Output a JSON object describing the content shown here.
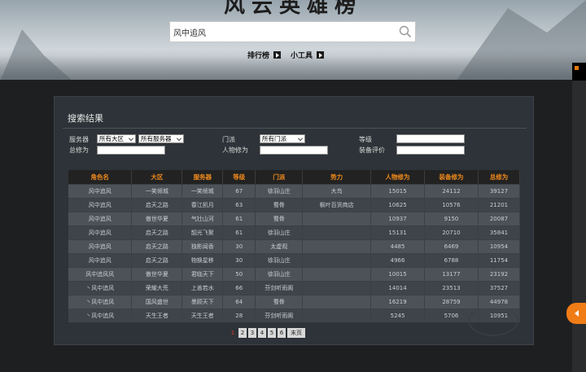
{
  "header": {
    "logo_text": "风云英雄榜",
    "search": {
      "value": "风中追风"
    },
    "nav": [
      {
        "label": "排行榜"
      },
      {
        "label": "小工具"
      }
    ]
  },
  "results": {
    "title": "搜索结果",
    "filters": {
      "server_label": "服务器",
      "region_select": "所有大区",
      "server_select": "所有服务器",
      "sect_label": "门派",
      "sect_select": "所有门派",
      "level_label": "等级",
      "total_power_label": "总修为",
      "char_power_label": "人物修为",
      "equip_label": "装备评价"
    },
    "columns": [
      "角色名",
      "大区",
      "服务器",
      "等级",
      "门派",
      "势力",
      "人物修为",
      "装备修为",
      "总修为"
    ],
    "rows": [
      [
        "风中追风",
        "一笑倾城",
        "一笑倾城",
        "67",
        "徐羽山庄",
        "大鸟",
        "15015",
        "24112",
        "39127"
      ],
      [
        "风中追风",
        "启天之路",
        "春江凯月",
        "63",
        "蜀骨",
        "枫叶百货商店",
        "10625",
        "10576",
        "21201"
      ],
      [
        "风中追风",
        "傲世华夏",
        "气壮山河",
        "61",
        "蜀骨",
        "",
        "10937",
        "9150",
        "20087"
      ],
      [
        "风中追风",
        "启天之路",
        "韶光飞絮",
        "61",
        "徐羽山庄",
        "",
        "15131",
        "20710",
        "35841"
      ],
      [
        "风中追风",
        "启天之路",
        "独影闻香",
        "30",
        "太虚观",
        "",
        "4485",
        "6469",
        "10954"
      ],
      [
        "风中追风",
        "启天之路",
        "物换星移",
        "30",
        "徐羽山庄",
        "",
        "4966",
        "6788",
        "11754"
      ],
      [
        "风中追风风",
        "傲世华夏",
        "君临天下",
        "50",
        "徐羽山庄",
        "",
        "10015",
        "13177",
        "23192"
      ],
      [
        "丶风中追风",
        "荣耀大荒",
        "上善若水",
        "66",
        "芬剑听雨阁",
        "",
        "14014",
        "23513",
        "37527"
      ],
      [
        "丶风中追风",
        "国风盛世",
        "墨顾天下",
        "64",
        "蜀骨",
        "",
        "16219",
        "28759",
        "44978"
      ],
      [
        "丶风中追风",
        "天生王者",
        "天生王者",
        "28",
        "芬剑听雨阁",
        "",
        "5245",
        "5706",
        "10951"
      ]
    ],
    "pagination": {
      "pages": [
        "1",
        "2",
        "3",
        "4",
        "5",
        "6"
      ],
      "current": "1",
      "last_label": "末页"
    }
  },
  "colors": {
    "accent": "#f08a1c",
    "panel_bg": "#2d3338",
    "row_odd": "#4c5257",
    "row_even": "#3e4449"
  }
}
